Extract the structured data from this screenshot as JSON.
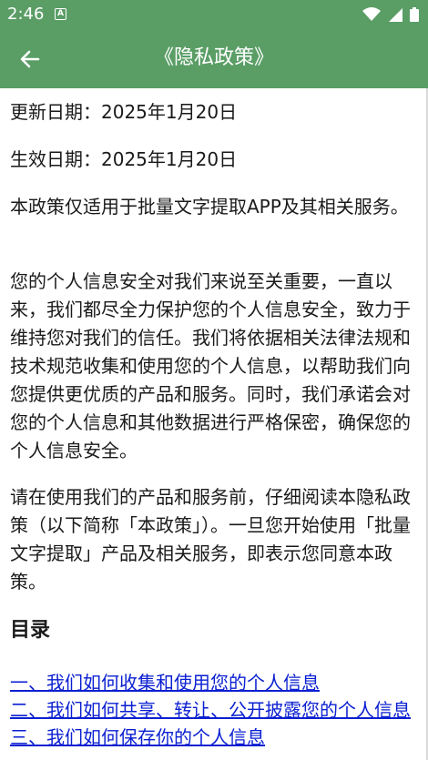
{
  "status_bar": {
    "time": "2:46",
    "notification_icon": "A",
    "icons": [
      "wifi-icon",
      "signal-icon",
      "battery-icon"
    ]
  },
  "app_bar": {
    "title": "《隐私政策》",
    "back_icon": "arrow-left-icon",
    "color": "#5a9e66"
  },
  "content": {
    "update_date": "更新日期：2025年1月20日",
    "effective_date": "生效日期：2025年1月20日",
    "scope": "本政策仅适用于批量文字提取APP及其相关服务。",
    "intro": "您的个人信息安全对我们来说至关重要，一直以来，我们都尽全力保护您的个人信息安全，致力于维持您对我们的信任。我们将依据相关法律法规和技术规范收集和使用您的个人信息，以帮助我们向您提供更优质的产品和服务。同时，我们承诺会对您的个人信息和其他数据进行严格保密，确保您的个人信息安全。",
    "read_notice": "请在使用我们的产品和服务前，仔细阅读本隐私政策（以下简称「本政策」）。一旦您开始使用「批量文字提取」产品及相关服务，即表示您同意本政策。",
    "toc_heading": "目录",
    "toc": [
      "一、我们如何收集和使用您的个人信息",
      "二、我们如何共享、转让、公开披露您的个人信息",
      "三、我们如何保存你的个人信息"
    ],
    "link_color": "#0a1fd1"
  }
}
